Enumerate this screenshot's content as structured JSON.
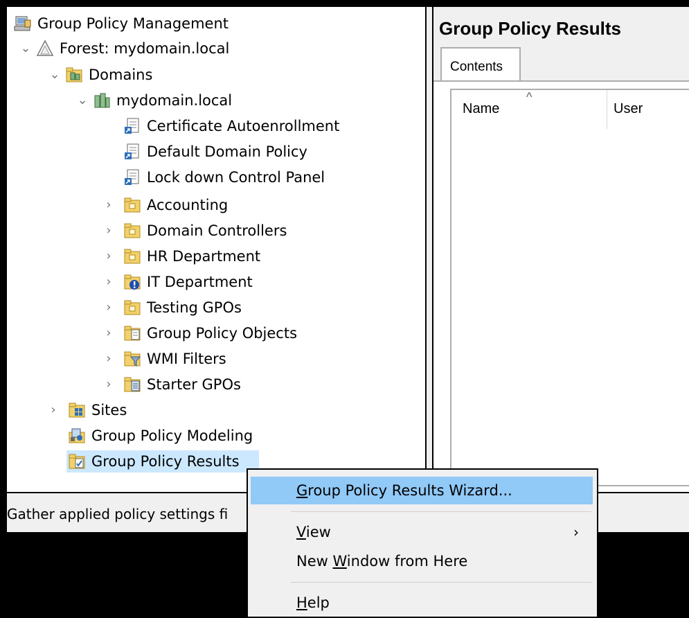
{
  "tree": {
    "items": [
      {
        "label": "Group Policy Management",
        "icon": "gpm-console-icon"
      },
      {
        "label": "Forest: mydomain.local",
        "icon": "forest-icon"
      },
      {
        "label": "Domains",
        "icon": "domains-folder-icon"
      },
      {
        "label": "mydomain.local",
        "icon": "domain-icon"
      },
      {
        "label": "Certificate Autoenrollment",
        "icon": "gpo-link-icon"
      },
      {
        "label": "Default Domain Policy",
        "icon": "gpo-link-icon"
      },
      {
        "label": "Lock down Control Panel",
        "icon": "gpo-link-icon"
      },
      {
        "label": "Accounting",
        "icon": "ou-folder-icon"
      },
      {
        "label": "Domain Controllers",
        "icon": "ou-folder-icon"
      },
      {
        "label": "HR Department",
        "icon": "ou-folder-icon"
      },
      {
        "label": "IT Department",
        "icon": "ou-blocked-icon"
      },
      {
        "label": "Testing GPOs",
        "icon": "ou-folder-icon"
      },
      {
        "label": "Group Policy Objects",
        "icon": "gpo-folder-icon"
      },
      {
        "label": "WMI Filters",
        "icon": "wmi-filter-folder-icon"
      },
      {
        "label": "Starter GPOs",
        "icon": "starter-gpo-folder-icon"
      },
      {
        "label": "Sites",
        "icon": "sites-folder-icon"
      },
      {
        "label": "Group Policy Modeling",
        "icon": "modeling-icon"
      },
      {
        "label": "Group Policy Results",
        "icon": "results-icon"
      }
    ]
  },
  "right_pane": {
    "title": "Group Policy Results",
    "tab": "Contents",
    "columns": [
      "Name",
      "User"
    ]
  },
  "statusbar": {
    "text": "Gather applied policy settings fi"
  },
  "context_menu": {
    "items": [
      {
        "label": "Group Policy Results Wizard...",
        "underline": "G",
        "rest": "roup Policy Results Wizard..."
      },
      {
        "label": "View",
        "underline": "V",
        "rest": "iew",
        "submenu_arrow": "›"
      },
      {
        "label": "New Window from Here",
        "pre": "New ",
        "underline": "W",
        "rest": "indow from Here"
      },
      {
        "label": "Help",
        "underline": "H",
        "rest": "elp"
      }
    ]
  },
  "colors": {
    "selection": "#cce8ff",
    "menu_highlight": "#91c9f7",
    "pane_bg": "#f0f0f0"
  }
}
